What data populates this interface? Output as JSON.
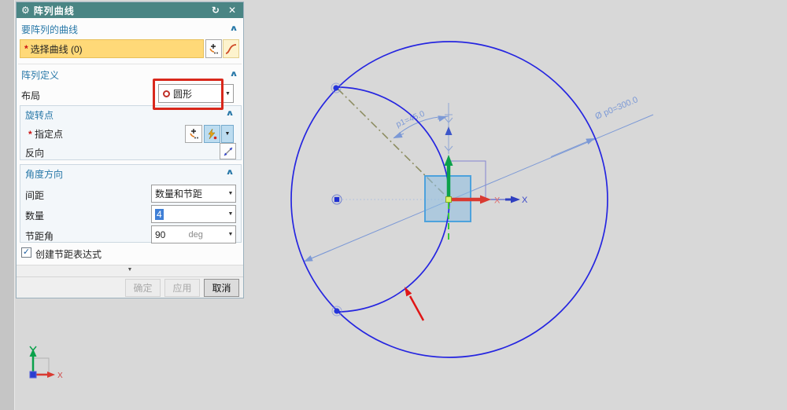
{
  "icons": {
    "gear": "⚙",
    "reset": "↻",
    "close": "✕",
    "chevron_up": "∧",
    "dropdown": "▼",
    "check": "✓",
    "more": "▼",
    "asterisk": "*"
  },
  "dialog": {
    "title": "阵列曲线",
    "curves_section": {
      "header": "要阵列的曲线",
      "select_label": "选择曲线 (0)"
    },
    "definition_section": {
      "header": "阵列定义",
      "layout_label": "布局",
      "layout_value": "圆形"
    },
    "rotation_section": {
      "header": "旋转点",
      "specify_label": "指定点",
      "reverse_label": "反向"
    },
    "angle_section": {
      "header": "角度方向",
      "spacing_label": "间距",
      "spacing_value": "数量和节距",
      "count_label": "数量",
      "count_value": "4",
      "pitch_label": "节距角",
      "pitch_value": "90",
      "pitch_unit": "deg"
    },
    "expression_checkbox_label": "创建节距表达式",
    "footer": {
      "ok": "确定",
      "apply": "应用",
      "cancel": "取消"
    }
  },
  "viewport": {
    "diameter_dim": "Ø p0=300.0",
    "angle_dim": "p1=45.0",
    "x_axis_label_red": "X",
    "x_axis_label_blue": "X",
    "triad_x_label": "X"
  }
}
